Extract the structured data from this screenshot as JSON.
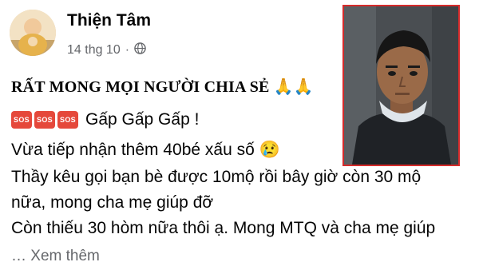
{
  "post": {
    "author": "Thiện Tâm",
    "date": "14 thg 10",
    "separator": "·",
    "headline": "RẤT MONG MỌI NGƯỜI CHIA SẺ 🙏🙏",
    "sos_label": "SOS",
    "urgent_text": "Gấp Gấp Gấp !",
    "body_lines": [
      "Vừa tiếp nhận thêm 40bé xấu số 😢",
      "Thầy kêu gọi bạn bè được 10mộ rồi bây giờ còn 30 mộ",
      "nữa, mong cha mẹ giúp đỡ",
      "Còn thiếu 30 hòm nữa thôi ạ. Mong MTQ và cha mẹ giúp"
    ],
    "see_more": "… Xem thêm"
  },
  "icons": {
    "privacy": "globe-icon",
    "urgent_badge": "sos-icon"
  },
  "colors": {
    "sos_badge": "#e5483b",
    "photo_border": "#d62b2b",
    "meta_text": "#65676b"
  }
}
